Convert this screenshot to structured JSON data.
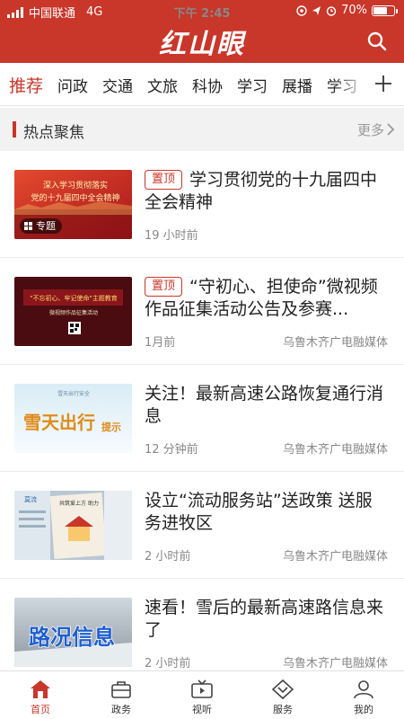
{
  "status_bar": {
    "carrier": "中国联通",
    "network": "4G",
    "time": "下午 2:45",
    "battery_percent": "70%",
    "battery_level": 0.7
  },
  "app": {
    "logo": "红山眼"
  },
  "tabs": [
    {
      "label": "推荐",
      "active": true
    },
    {
      "label": "问政"
    },
    {
      "label": "交通"
    },
    {
      "label": "文旅"
    },
    {
      "label": "科协"
    },
    {
      "label": "学习"
    },
    {
      "label": "展播"
    },
    {
      "label": "学习"
    }
  ],
  "section": {
    "title": "热点聚焦",
    "more": "更多"
  },
  "thumbs": {
    "t1": {
      "line1": "深入学习贯彻落实",
      "line2": "党的十九届四中全会精神",
      "badge": "专题"
    },
    "t2": {
      "line1": "\"不忘初心、牢记使命\"主题教育",
      "line2": "微视频作品征集活动"
    },
    "t3": {
      "top": "雪天出行安全",
      "main": "雪天出行",
      "sub": "提示"
    },
    "t4": {
      "left": "莫流",
      "right": "共筑爱上方 助力"
    },
    "t5": {
      "main": "路况信息"
    }
  },
  "news": [
    {
      "tag": "置顶",
      "title": "学习贯彻党的十九届四中全会精神",
      "time": "19 小时前",
      "source": ""
    },
    {
      "tag": "置顶",
      "title": "“守初心、担使命”微视频作品征集活动公告及参赛...",
      "time": "1月前",
      "source": "乌鲁木齐广电融媒体"
    },
    {
      "tag": "",
      "title": "关注！最新高速公路恢复通行消息",
      "time": "12 分钟前",
      "source": "乌鲁木齐广电融媒体"
    },
    {
      "tag": "",
      "title": "设立“流动服务站”送政策 送服务进牧区",
      "time": "2 小时前",
      "source": "乌鲁木齐广电融媒体"
    },
    {
      "tag": "",
      "title": "速看！雪后的最新高速路信息来了",
      "time": "2 小时前",
      "source": "乌鲁木齐广电融媒体"
    }
  ],
  "bottom_nav": [
    {
      "label": "首页",
      "icon": "home-icon",
      "active": true
    },
    {
      "label": "政务",
      "icon": "briefcase-icon"
    },
    {
      "label": "视听",
      "icon": "tv-icon"
    },
    {
      "label": "服务",
      "icon": "diamond-icon"
    },
    {
      "label": "我的",
      "icon": "user-icon"
    }
  ],
  "colors": {
    "brand": "#c9362a",
    "muted": "#888888",
    "section_bg": "#f2f2f2"
  }
}
